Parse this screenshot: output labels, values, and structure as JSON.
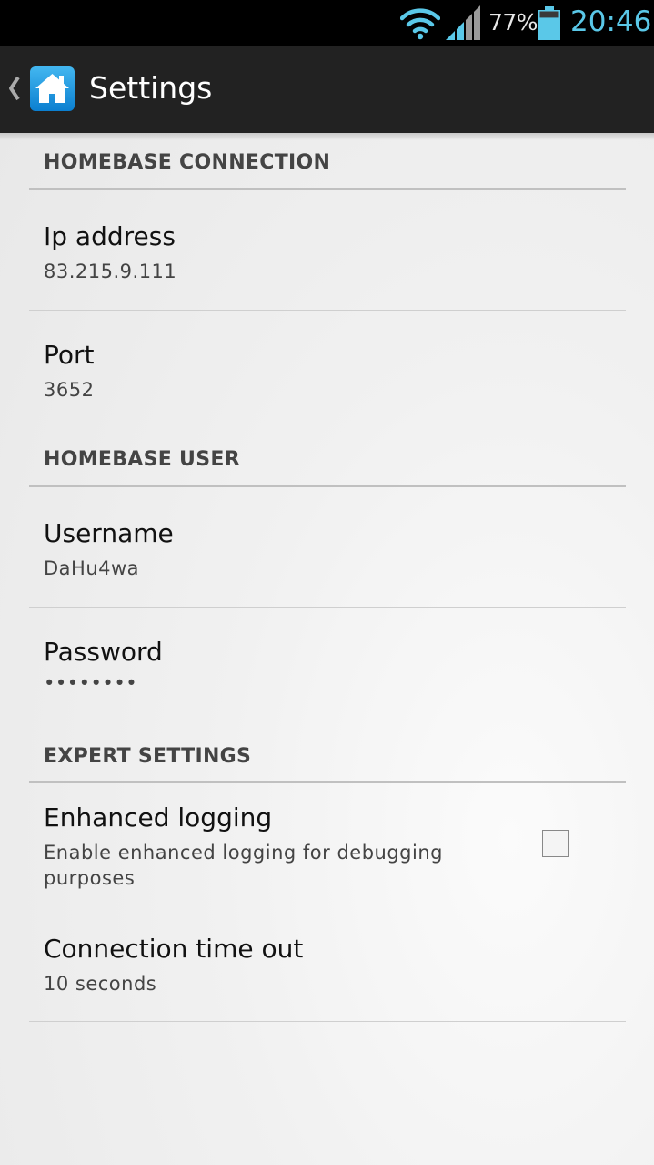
{
  "status_bar": {
    "battery_percent": "77%",
    "battery_level": 0.77,
    "time": "20:46",
    "wifi_icon": "wifi-icon",
    "signal_icon": "cell-signal-icon",
    "battery_icon": "battery-icon",
    "accent_color": "#5ac8e8"
  },
  "action_bar": {
    "title": "Settings",
    "up_icon": "chevron-left-icon",
    "app_icon": "home-icon"
  },
  "sections": {
    "homebase_connection": {
      "header": "HOMEBASE CONNECTION",
      "ip_address": {
        "title": "Ip address",
        "summary": "83.215.9.111"
      },
      "port": {
        "title": "Port",
        "summary": "3652"
      }
    },
    "homebase_user": {
      "header": "HOMEBASE USER",
      "username": {
        "title": "Username",
        "summary": "DaHu4wa"
      },
      "password": {
        "title": "Password",
        "summary": "••••••••"
      }
    },
    "expert_settings": {
      "header": "EXPERT SETTINGS",
      "enhanced_logging": {
        "title": "Enhanced logging",
        "summary": "Enable enhanced logging for debugging purposes",
        "checked": false
      },
      "connection_timeout": {
        "title": "Connection time out",
        "summary": "10 seconds"
      }
    }
  }
}
